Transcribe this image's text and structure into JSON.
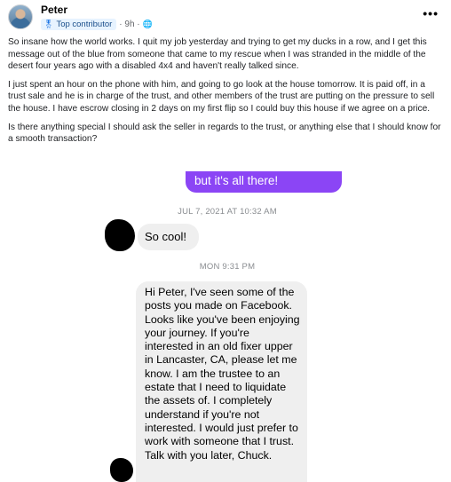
{
  "post": {
    "author": "Peter",
    "badge": "Top contributor",
    "time": "· 9h ·",
    "more": "•••",
    "paragraphs": [
      "So insane how the world works. I quit my job yesterday and trying to get my ducks in a row, and I get this message out of the blue from someone that came to my rescue when I was stranded in the middle of the desert four years ago with a disabled 4x4 and haven't really talked since.",
      "I just spent an hour on the phone with him, and going to go look at the house tomorrow. It is paid off, in a trust sale and he is in charge of the trust, and other members of the trust are putting on the pressure to sell the house. I have escrow closing in 2 days on my first flip so I could buy this house if we agree on a price.",
      "Is there anything special I should ask the seller in regards to the trust, or anything else that I should know for a smooth transaction?"
    ]
  },
  "conversation": {
    "outgoing_partial": "but it's all there!",
    "timestamp_1": "JUL 7, 2021 AT 10:32 AM",
    "reply_1": "So cool!",
    "timestamp_2": "MON 9:31 PM",
    "message_long": "Hi Peter, I've seen some of the posts you made on Facebook. Looks like you've been enjoying your journey. If you're interested in an old fixer upper in Lancaster, CA, please let me know. I am the trustee to an estate that I need to liquidate the assets of. I completely understand if you're not interested. I would just prefer to work with someone that I trust. Talk with you later, Chuck."
  },
  "icons": [
    "avatar",
    "top-contributor-ribbon-icon",
    "globe-icon",
    "more-options-icon"
  ]
}
